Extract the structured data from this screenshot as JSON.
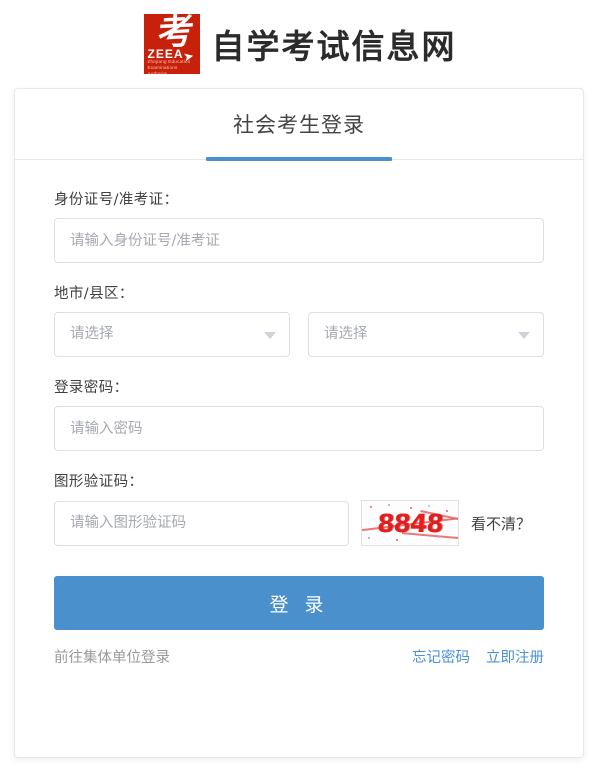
{
  "brand": {
    "logo_kao_char": "考",
    "logo_acronym": "ZEEA",
    "logo_subtitle": "Zhejiang Education Examinations Authority",
    "site_title": "自学考试信息网",
    "logo_color": "#c8210b"
  },
  "card": {
    "title": "社会考生登录",
    "accent_color": "#4a90d0"
  },
  "form": {
    "id_field": {
      "label": "身份证号/准考证：",
      "placeholder": "请输入身份证号/准考证",
      "value": ""
    },
    "region_field": {
      "label": "地市/县区：",
      "city_selected": "请选择",
      "district_selected": "请选择"
    },
    "password_field": {
      "label": "登录密码：",
      "placeholder": "请输入密码",
      "value": ""
    },
    "captcha_field": {
      "label": "图形验证码：",
      "placeholder": "请输入图形验证码",
      "value": "",
      "image_code": "8848",
      "refresh_label": "看不清？",
      "code_color": "#e02020"
    }
  },
  "actions": {
    "login_label": "登 录",
    "login_color": "#4a90cc",
    "group_login_label": "前往集体单位登录",
    "forgot_password_label": "忘记密码",
    "register_label": "立即注册",
    "link_color": "#4a90d9"
  }
}
